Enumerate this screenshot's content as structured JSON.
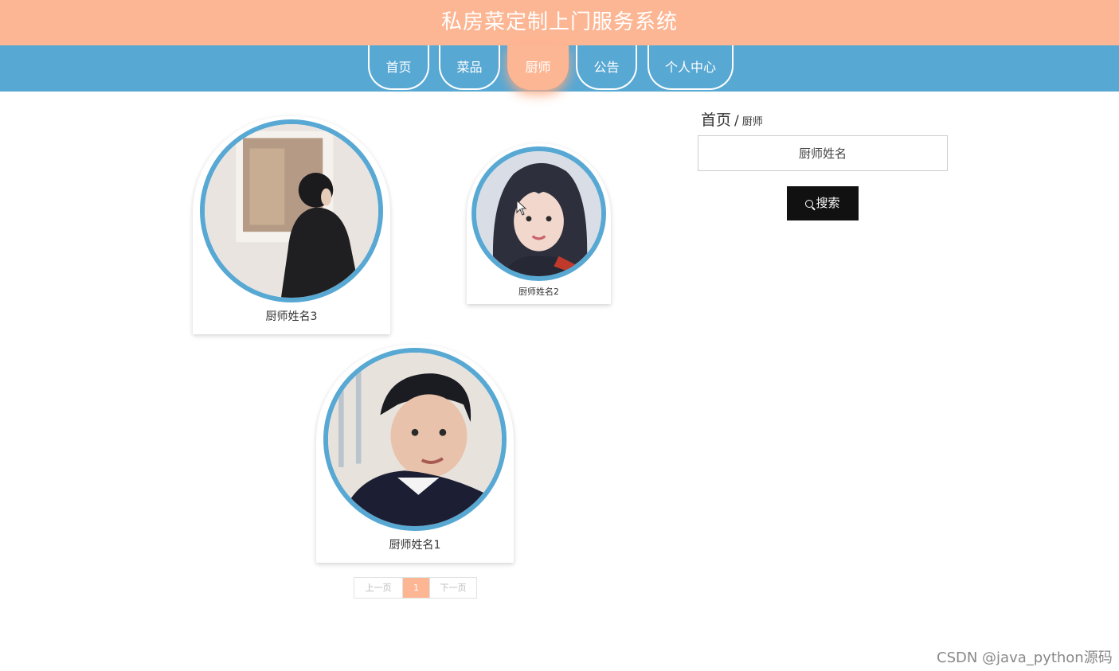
{
  "header": {
    "title": "私房菜定制上门服务系统"
  },
  "nav": {
    "items": [
      {
        "label": "首页"
      },
      {
        "label": "菜品"
      },
      {
        "label": "厨师"
      },
      {
        "label": "公告"
      },
      {
        "label": "个人中心"
      }
    ],
    "active_index": 2
  },
  "chefs": [
    {
      "name": "厨师姓名3"
    },
    {
      "name": "厨师姓名2"
    },
    {
      "name": "厨师姓名1"
    }
  ],
  "breadcrumb": {
    "home": "首页",
    "separator": "/",
    "current": "厨师"
  },
  "search": {
    "placeholder": "厨师姓名",
    "button_label": "搜索"
  },
  "pagination": {
    "prev": "上一页",
    "current": "1",
    "next": "下一页"
  },
  "watermark": "CSDN @java_python源码",
  "colors": {
    "header_bg": "#fdb693",
    "nav_bg": "#58a8d4",
    "avatar_ring": "#58a8d4",
    "button_bg": "#111111"
  }
}
